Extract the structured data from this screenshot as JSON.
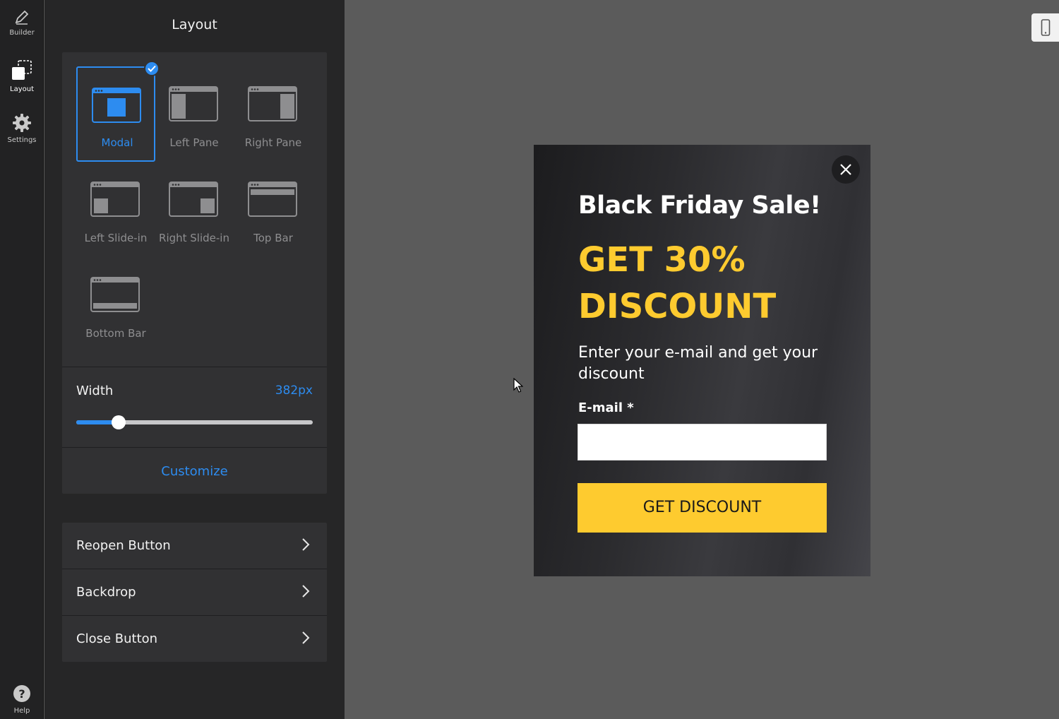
{
  "rail": {
    "builder": "Builder",
    "layout": "Layout",
    "settings": "Settings",
    "help": "Help"
  },
  "panel": {
    "title": "Layout",
    "layout_options": [
      {
        "label": "Modal",
        "selected": true
      },
      {
        "label": "Left Pane",
        "selected": false
      },
      {
        "label": "Right Pane",
        "selected": false
      },
      {
        "label": "Left Slide-in",
        "selected": false
      },
      {
        "label": "Right Slide-in",
        "selected": false
      },
      {
        "label": "Top Bar",
        "selected": false
      },
      {
        "label": "Bottom Bar",
        "selected": false
      }
    ],
    "width_label": "Width",
    "width_value": "382px",
    "width_slider_fraction": 0.18,
    "customize": "Customize",
    "sections": [
      {
        "label": "Reopen Button"
      },
      {
        "label": "Backdrop"
      },
      {
        "label": "Close Button"
      }
    ]
  },
  "modal": {
    "title": "Black Friday Sale!",
    "headline_line1": "GET 30%",
    "headline_line2": "DISCOUNT",
    "subtitle": "Enter your e-mail and get your discount",
    "email_label": "E-mail *",
    "email_value": "",
    "cta": "GET DISCOUNT"
  },
  "colors": {
    "accent": "#2d8cf0",
    "cta_yellow": "#fecb2f",
    "panel_bg": "#262627",
    "canvas_bg": "#5b5b5b"
  }
}
